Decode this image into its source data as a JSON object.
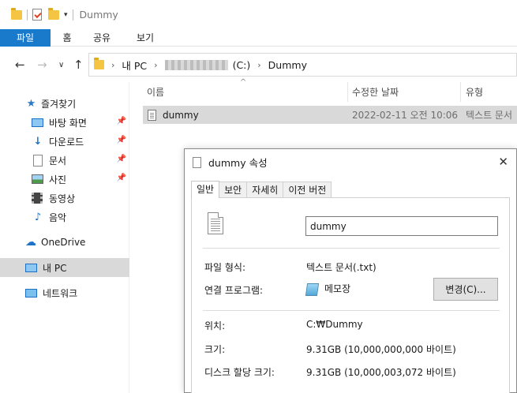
{
  "titlebar": {
    "title": "Dummy",
    "qa_dropdown": "▾"
  },
  "ribbon": {
    "tabs": [
      "파일",
      "홈",
      "공유",
      "보기"
    ]
  },
  "address": {
    "back": "←",
    "forward": "→",
    "recent": "∨",
    "up": "↑",
    "segments": [
      "내 PC",
      "(C:)",
      "Dummy"
    ],
    "chevron": "›"
  },
  "nav": {
    "quick_access": "즐겨찾기",
    "items": [
      {
        "label": "바탕 화면",
        "icon": "desktop-icon",
        "pinned": true
      },
      {
        "label": "다운로드",
        "icon": "download-icon",
        "pinned": true
      },
      {
        "label": "문서",
        "icon": "document-icon",
        "pinned": true
      },
      {
        "label": "사진",
        "icon": "pictures-icon",
        "pinned": true
      },
      {
        "label": "동영상",
        "icon": "video-icon",
        "pinned": false
      },
      {
        "label": "음악",
        "icon": "music-icon",
        "pinned": false
      }
    ],
    "onedrive": "OneDrive",
    "this_pc": "내 PC",
    "network": "네트워크",
    "pin_glyph": "📌"
  },
  "columns": [
    "이름",
    "수정한 날짜",
    "유형"
  ],
  "files": [
    {
      "name": "dummy",
      "modified": "2022-02-11 오전 10:06",
      "type": "텍스트 문서"
    }
  ],
  "dialog": {
    "title": "dummy 속성",
    "close": "✕",
    "tabs": [
      "일반",
      "보안",
      "자세히",
      "이전 버전"
    ],
    "file_name": "dummy",
    "type_label": "파일 형식:",
    "type_value": "텍스트 문서(.txt)",
    "opens_label": "연결 프로그램:",
    "opens_value": "메모장",
    "change_button": "변경(C)...",
    "location_label": "위치:",
    "location_value": "C:₩Dummy",
    "size_label": "크기:",
    "size_value": "9.31GB (10,000,000,000 바이트)",
    "disk_label": "디스크 할당 크기:",
    "disk_value": "9.31GB (10,000,003,072 바이트)"
  },
  "colors": {
    "accent": "#1979ca",
    "selection": "#d9d9d9",
    "folder": "#f4c542"
  }
}
